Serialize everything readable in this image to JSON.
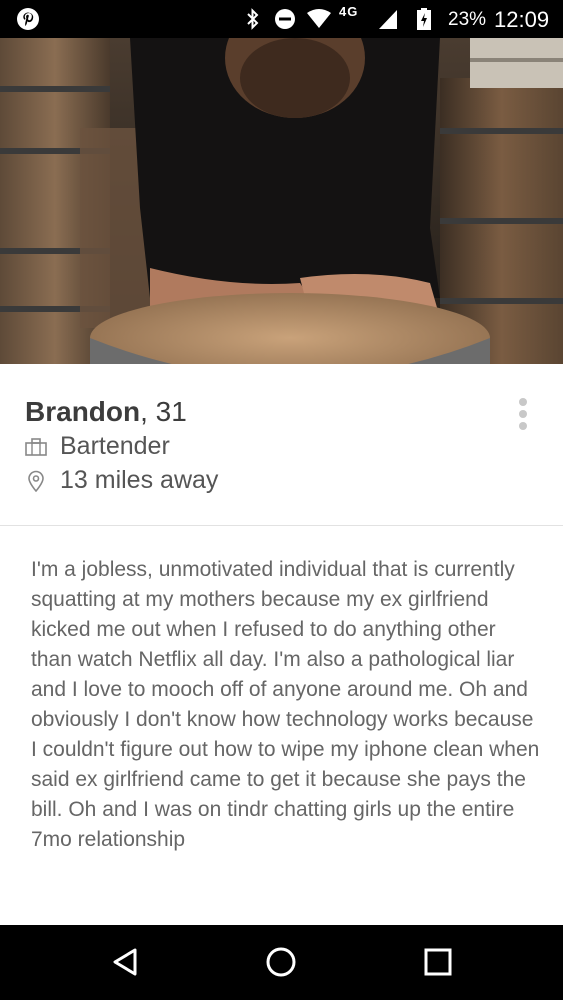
{
  "status_bar": {
    "network": "4G",
    "battery_percent": "23%",
    "time": "12:09"
  },
  "profile": {
    "name": "Brandon",
    "age": ", 31",
    "job": "Bartender",
    "distance": "13 miles away"
  },
  "bio": "I'm a jobless, unmotivated individual that is currently squatting at my mothers because my ex girlfriend kicked me out when I refused to do anything other than watch Netflix all day. I'm also a pathological liar and I love to mooch off of anyone around me. Oh and obviously I don't know how technology works because I couldn't figure out how to wipe my iphone clean when said ex girlfriend came to get it because she pays the bill. Oh and I was on tindr chatting girls up the entire 7mo relationship",
  "icons": {
    "app_notification": "pinterest-icon",
    "job": "briefcase-icon",
    "distance": "location-pin-icon",
    "menu": "more-vertical-icon",
    "nav": [
      "back-icon",
      "home-icon",
      "recents-icon"
    ]
  }
}
